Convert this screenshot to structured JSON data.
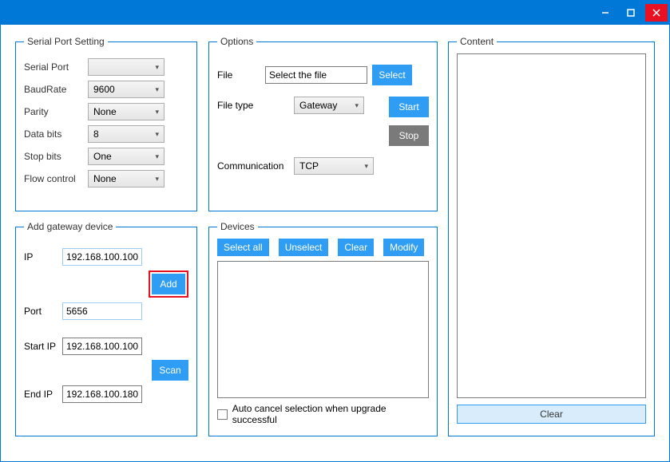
{
  "titlebar": {
    "minimize": "−",
    "maximize": "□",
    "close": "X"
  },
  "serial": {
    "legend": "Serial Port Setting",
    "port_lbl": "Serial Port",
    "port_val": "",
    "baud_lbl": "BaudRate",
    "baud_val": "9600",
    "parity_lbl": "Parity",
    "parity_val": "None",
    "databits_lbl": "Data bits",
    "databits_val": "8",
    "stopbits_lbl": "Stop bits",
    "stopbits_val": "One",
    "flow_lbl": "Flow control",
    "flow_val": "None"
  },
  "addgw": {
    "legend": "Add gateway device",
    "ip_lbl": "IP",
    "ip_val": "192.168.100.100",
    "port_lbl": "Port",
    "port_val": "5656",
    "startip_lbl": "Start IP",
    "startip_val": "192.168.100.100",
    "endip_lbl": "End IP",
    "endip_val": "192.168.100.180",
    "add_btn": "Add",
    "scan_btn": "Scan"
  },
  "options": {
    "legend": "Options",
    "file_lbl": "File",
    "file_val": "Select the file",
    "select_btn": "Select",
    "filetype_lbl": "File type",
    "filetype_val": "Gateway",
    "start_btn": "Start",
    "stop_btn": "Stop",
    "comm_lbl": "Communication",
    "comm_val": "TCP"
  },
  "devices": {
    "legend": "Devices",
    "selectall": "Select all",
    "unselect": "Unselect",
    "clear": "Clear",
    "modify": "Modify",
    "autocancel": "Auto cancel selection when upgrade successful"
  },
  "content": {
    "legend": "Content",
    "clear": "Clear"
  }
}
